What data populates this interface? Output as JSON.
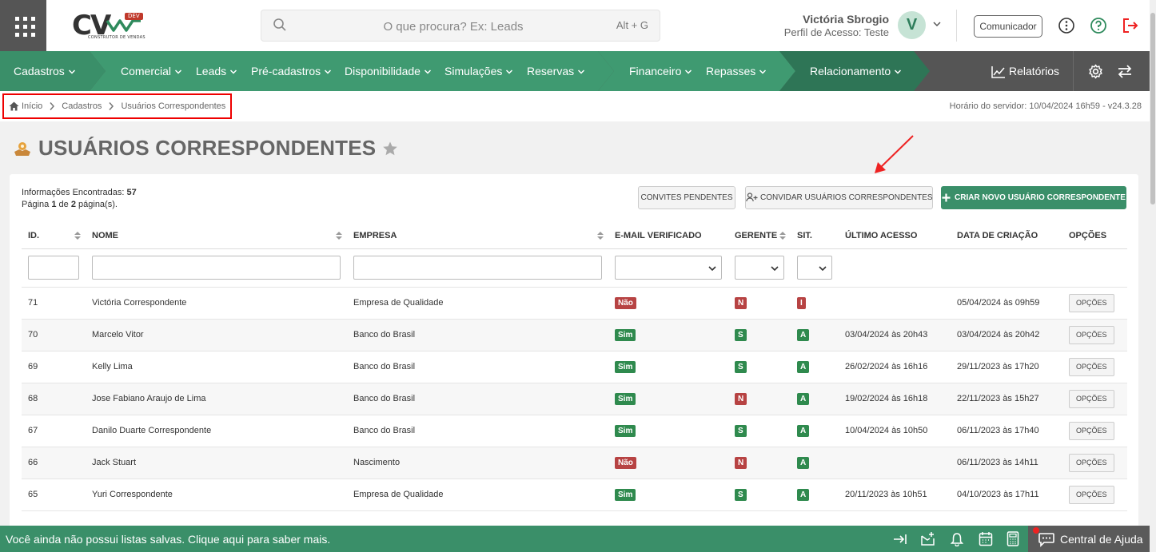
{
  "header": {
    "logo_text": "CV",
    "logo_badge": "DEV",
    "logo_subtitle": "CONSTRUTOR DE VENDAS",
    "search_placeholder": "O que procura? Ex: Leads",
    "search_shortcut": "Alt + G",
    "user_name": "Victória Sbrogio",
    "user_role": "Perfil de Acesso: Teste",
    "avatar_letter": "V",
    "comunicador_label": "Comunicador"
  },
  "nav": {
    "items": [
      "Cadastros",
      "Comercial",
      "Leads",
      "Pré-cadastros",
      "Disponibilidade",
      "Simulações",
      "Reservas",
      "Financeiro",
      "Repasses",
      "Relacionamento"
    ],
    "reports_label": "Relatórios",
    "colors": {
      "seg1": "#3a8f69",
      "seg2": "#3f9a71",
      "seg3": "#3f9a71",
      "seg4": "#2e7556",
      "dark": "#555555"
    }
  },
  "breadcrumb": {
    "items": [
      "Início",
      "Cadastros",
      "Usuários Correspondentes"
    ],
    "server_time": "Horário do servidor: 10/04/2024 16h59 - v24.3.28"
  },
  "page": {
    "title": "USUÁRIOS CORRESPONDENTES",
    "info_found_label": "Informações Encontradas:",
    "info_found_count": "57",
    "info_page_prefix": "Página",
    "info_page_current": "1",
    "info_page_of": "de",
    "info_page_total": "2",
    "info_page_suffix": "página(s).",
    "btn_pending": "CONVITES PENDENTES",
    "btn_invite": "CONVIDAR USUÁRIOS CORRESPONDENTES",
    "btn_create": "CRIAR NOVO USUÁRIO CORRESPONDENTE"
  },
  "table": {
    "columns": [
      "ID.",
      "NOME",
      "EMPRESA",
      "E-MAIL VERIFICADO",
      "GERENTE",
      "SIT.",
      "ÚLTIMO ACESSO",
      "DATA DE CRIAÇÃO",
      "OPÇÕES"
    ],
    "option_label": "OPÇÕES",
    "rows": [
      {
        "id": "71",
        "nome": "Victória Correspondente",
        "empresa": "Empresa de Qualidade",
        "email": "Não",
        "gerente": "N",
        "sit": "I",
        "ultimo": "",
        "criacao": "05/04/2024 às 09h59"
      },
      {
        "id": "70",
        "nome": "Marcelo Vitor",
        "empresa": "Banco do Brasil",
        "email": "Sim",
        "gerente": "S",
        "sit": "A",
        "ultimo": "03/04/2024 às 20h43",
        "criacao": "03/04/2024 às 20h42"
      },
      {
        "id": "69",
        "nome": "Kelly Lima",
        "empresa": "Banco do Brasil",
        "email": "Sim",
        "gerente": "S",
        "sit": "A",
        "ultimo": "26/02/2024 às 16h16",
        "criacao": "29/11/2023 às 17h20"
      },
      {
        "id": "68",
        "nome": "Jose Fabiano Araujo de Lima",
        "empresa": "Banco do Brasil",
        "email": "Sim",
        "gerente": "N",
        "sit": "A",
        "ultimo": "19/02/2024 às 16h18",
        "criacao": "22/11/2023 às 15h27"
      },
      {
        "id": "67",
        "nome": "Danilo Duarte Correspondente",
        "empresa": "Banco do Brasil",
        "email": "Sim",
        "gerente": "S",
        "sit": "A",
        "ultimo": "10/04/2024 às 10h50",
        "criacao": "06/11/2023 às 17h40"
      },
      {
        "id": "66",
        "nome": "Jack Stuart",
        "empresa": "Nascimento",
        "email": "Não",
        "gerente": "N",
        "sit": "A",
        "ultimo": "",
        "criacao": "06/11/2023 às 14h11"
      },
      {
        "id": "65",
        "nome": "Yuri Correspondente",
        "empresa": "Empresa de Qualidade",
        "email": "Sim",
        "gerente": "S",
        "sit": "A",
        "ultimo": "20/11/2023 às 10h51",
        "criacao": "04/10/2023 às 17h11"
      }
    ]
  },
  "footer": {
    "message": "Você ainda não possui listas salvas. Clique aqui para saber mais.",
    "help_label": "Central de Ajuda"
  }
}
